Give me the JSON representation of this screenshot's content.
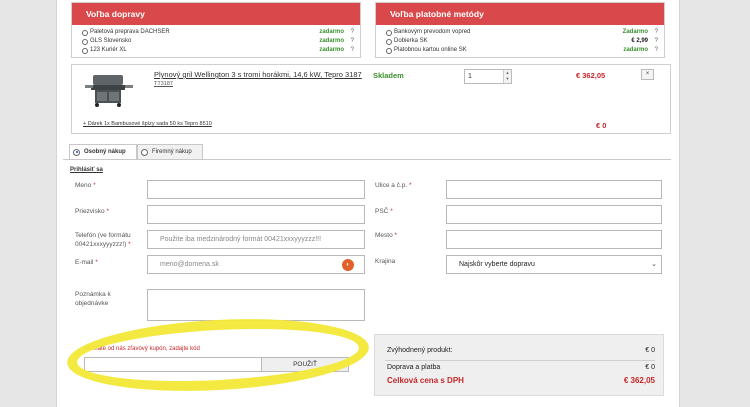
{
  "shipping": {
    "title": "Voľba dopravy",
    "options": [
      {
        "label": "Paletová preprava DACHSER",
        "price": "zadarmo",
        "help": "?"
      },
      {
        "label": "GLS Slovensko",
        "price": "zadarmo",
        "help": "?"
      },
      {
        "label": "123 Kuriér XL",
        "price": "zadarmo",
        "help": "?"
      }
    ]
  },
  "payment": {
    "title": "Voľba platobné metódy",
    "options": [
      {
        "label": "Bankovým prevodom vopred",
        "price": "Zadarmo",
        "help": "?"
      },
      {
        "label": "Dobierka SK",
        "price": "€ 2,99",
        "help": "?"
      },
      {
        "label": "Platobnou kartou online SK",
        "price": "zadarmo",
        "help": "?"
      }
    ]
  },
  "product": {
    "name": "Plynový gril Wellington 3 s tromi horákmi, 14,6 kW, Tepro 3187",
    "code": "TT3187",
    "stock": "Skladem",
    "quantity": "1",
    "price": "€ 362,05",
    "remove": "×",
    "gift": "+ Dárek 1x Bambusové špízy sada 50 ks Tepro 8510",
    "gift_price": "€ 0"
  },
  "tabs": [
    {
      "label": "Osobný nákup",
      "active": true
    },
    {
      "label": "Firemný nákup",
      "active": false
    }
  ],
  "login_link": "Prihlásiť sa",
  "form": {
    "left": [
      {
        "label": "Meno",
        "required": "*",
        "value": ""
      },
      {
        "label": "Priezvisko",
        "required": "*",
        "value": ""
      },
      {
        "label": "Telefón (ve formátu 00421xxxyyyzzz!)",
        "required": "*",
        "placeholder": "Použite iba medzinárodný formát 00421xxxyyyzzz!!!"
      },
      {
        "label": "E-mail",
        "required": "*",
        "placeholder": "meno@domena.sk"
      },
      {
        "label": "Poznámka k objednávke",
        "required": "",
        "value": ""
      }
    ],
    "right": [
      {
        "label": "Ulice a č.p.",
        "required": "*"
      },
      {
        "label": "PSČ",
        "required": "*"
      },
      {
        "label": "Mesto",
        "required": "*"
      },
      {
        "label": "Krajina",
        "required": "",
        "select_value": "Najskôr vyberte dopravu"
      }
    ]
  },
  "coupon": {
    "label": "Ak máte od nás zľavový kupón, zadajte kód",
    "button": "POUŽIŤ"
  },
  "summary": {
    "discount_label": "Zvýhodnený produkt:",
    "discount_value": "€ 0",
    "shipping_label": "Doprava a platba",
    "shipping_value": "€ 0",
    "total_label": "Celková cena s DPH",
    "total_value": "€ 362,05"
  },
  "colors": {
    "accent": "#d9494b",
    "green": "#3a8f2d",
    "red": "#c4272a",
    "highlight": "#f3e837"
  }
}
